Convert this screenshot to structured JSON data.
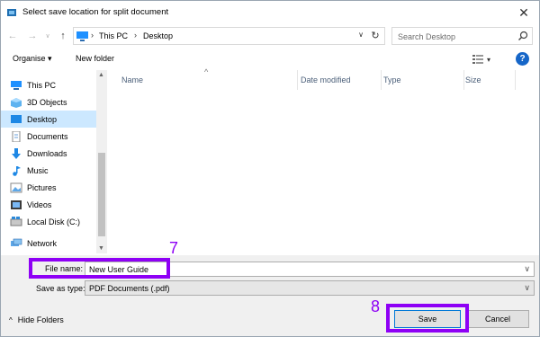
{
  "window": {
    "title": "Select save location for split document",
    "close_glyph": "✕"
  },
  "nav": {
    "back_glyph": "←",
    "forward_glyph": "→",
    "recent_glyph": "∨",
    "up_glyph": "↑",
    "breadcrumb": [
      "This PC",
      "Desktop"
    ],
    "breadcrumb_sep": "›",
    "dropdown_glyph": "∨",
    "refresh_glyph": "↻",
    "search_placeholder": "Search Desktop"
  },
  "toolbar": {
    "organise_label": "Organise ▾",
    "new_folder_label": "New folder",
    "view_caret": "▾",
    "help_glyph": "?"
  },
  "sidebar": {
    "items": [
      {
        "label": "This PC",
        "icon": "pc-icon"
      },
      {
        "label": "3D Objects",
        "icon": "cube-icon"
      },
      {
        "label": "Desktop",
        "icon": "desktop-icon",
        "selected": true
      },
      {
        "label": "Documents",
        "icon": "documents-icon"
      },
      {
        "label": "Downloads",
        "icon": "download-icon"
      },
      {
        "label": "Music",
        "icon": "music-icon"
      },
      {
        "label": "Pictures",
        "icon": "pictures-icon"
      },
      {
        "label": "Videos",
        "icon": "videos-icon"
      },
      {
        "label": "Local Disk (C:)",
        "icon": "disk-icon"
      },
      {
        "label": "Network",
        "icon": "network-icon"
      }
    ]
  },
  "file_list": {
    "columns": [
      "Name",
      "Date modified",
      "Type",
      "Size"
    ],
    "sort_glyph": "^"
  },
  "save_form": {
    "file_name_label": "File name:",
    "file_name_value": "New User Guide",
    "save_as_type_label": "Save as type:",
    "save_as_type_value": "PDF Documents (.pdf)",
    "dropdown_glyph": "∨"
  },
  "buttons": {
    "save_label": "Save",
    "cancel_label": "Cancel",
    "hide_folders_label": "Hide Folders"
  },
  "annotations": {
    "step_file_name": "7",
    "step_save": "8",
    "highlight_color": "#8e00f5"
  }
}
